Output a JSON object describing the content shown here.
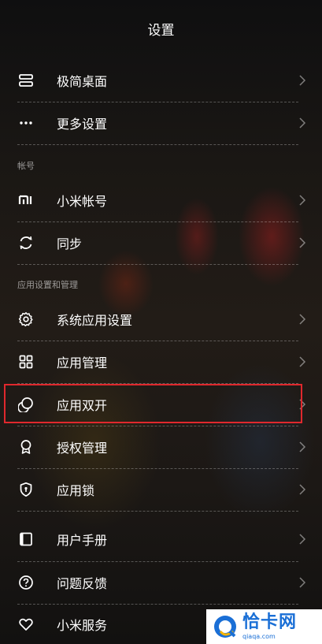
{
  "header": {
    "title": "设置"
  },
  "sections": {
    "account": "帐号",
    "apps": "应用设置和管理"
  },
  "items": [
    {
      "label": "极简桌面",
      "icon": "layout-icon"
    },
    {
      "label": "更多设置",
      "icon": "more-dots-icon"
    },
    {
      "label": "小米帐号",
      "icon": "mi-logo-icon"
    },
    {
      "label": "同步",
      "icon": "sync-icon"
    },
    {
      "label": "系统应用设置",
      "icon": "gear-icon"
    },
    {
      "label": "应用管理",
      "icon": "grid-icon"
    },
    {
      "label": "应用双开",
      "icon": "dual-app-icon"
    },
    {
      "label": "授权管理",
      "icon": "badge-icon"
    },
    {
      "label": "应用锁",
      "icon": "shield-lock-icon"
    },
    {
      "label": "用户手册",
      "icon": "book-icon"
    },
    {
      "label": "问题反馈",
      "icon": "question-icon"
    },
    {
      "label": "小米服务",
      "icon": "heart-icon"
    }
  ],
  "highlight_color": "#e0282d",
  "watermark": {
    "title": "恰卡网",
    "url": "qiaqa.com"
  }
}
